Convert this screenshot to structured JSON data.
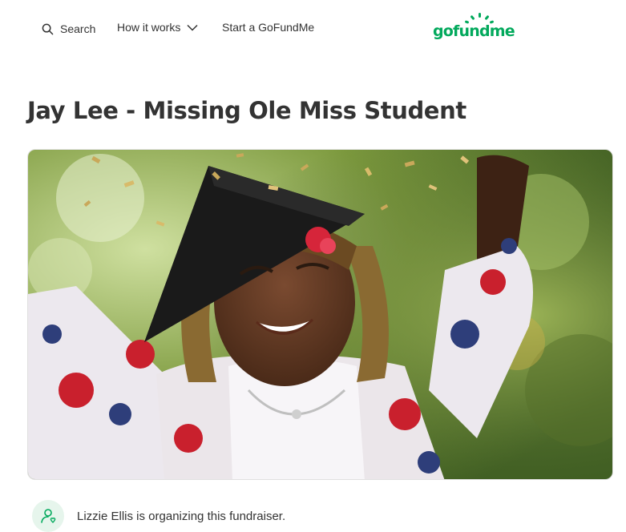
{
  "nav": {
    "search_label": "Search",
    "how_label": "How it works",
    "start_label": "Start a GoFundMe"
  },
  "logo": {
    "text": "gofundme",
    "color": "#02a95c"
  },
  "campaign": {
    "title": "Jay Lee - Missing Ole Miss Student",
    "organizer_text": "Lizzie Ellis is organizing this fundraiser."
  },
  "icons": {
    "search": "search-icon",
    "chevron": "chevron-down-icon",
    "organizer": "user-heart-icon"
  },
  "colors": {
    "brand_green": "#02a95c",
    "text": "#333333",
    "avatar_bg": "#e6f5ec"
  }
}
